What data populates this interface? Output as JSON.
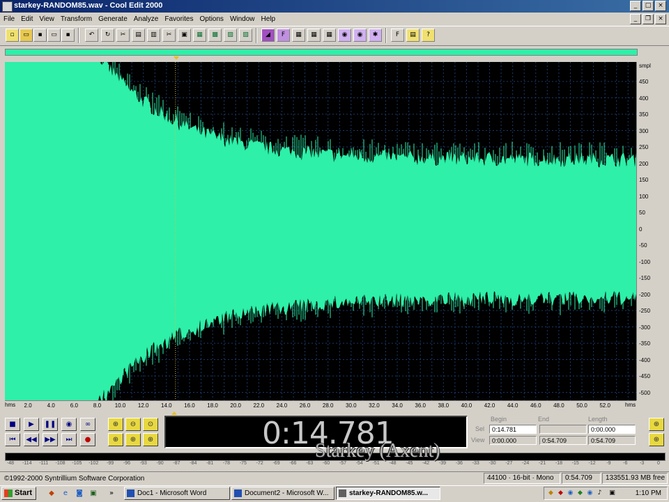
{
  "window": {
    "title": "starkey-RANDOM85.wav - Cool Edit 2000"
  },
  "menu": [
    "File",
    "Edit",
    "View",
    "Transform",
    "Generate",
    "Analyze",
    "Favorites",
    "Options",
    "Window",
    "Help"
  ],
  "timeline": {
    "unit": "hms",
    "ticks": [
      "2.0",
      "4.0",
      "6.0",
      "8.0",
      "10.0",
      "12.0",
      "14.0",
      "16.0",
      "18.0",
      "20.0",
      "22.0",
      "24.0",
      "26.0",
      "28.0",
      "30.0",
      "32.0",
      "34.0",
      "36.0",
      "38.0",
      "40.0",
      "42.0",
      "44.0",
      "46.0",
      "48.0",
      "50.0",
      "52.0"
    ]
  },
  "amplitude_scale": {
    "unit": "smpl",
    "ticks": [
      "450",
      "400",
      "350",
      "300",
      "250",
      "200",
      "150",
      "100",
      "50",
      "0",
      "-50",
      "-100",
      "-150",
      "-200",
      "-250",
      "-300",
      "-350",
      "-400",
      "-450",
      "-500"
    ]
  },
  "time_display": "0:14.781",
  "selection": {
    "headers": {
      "begin": "Begin",
      "end": "End",
      "length": "Length"
    },
    "sel_label": "Sel",
    "view_label": "View",
    "sel": {
      "begin": "0:14.781",
      "end": "",
      "length": "0:00.000"
    },
    "view": {
      "begin": "0:00.000",
      "end": "0:54.709",
      "length": "0:54.709"
    }
  },
  "level_meter": {
    "ticks": [
      "-48",
      "-114",
      "-111",
      "-108",
      "-105",
      "-102",
      "-99",
      "-96",
      "-93",
      "-90",
      "-87",
      "-84",
      "-81",
      "-78",
      "-75",
      "-72",
      "-69",
      "-66",
      "-63",
      "-60",
      "-57",
      "-54",
      "-51",
      "-48",
      "-45",
      "-42",
      "-39",
      "-36",
      "-33",
      "-30",
      "-27",
      "-24",
      "-21",
      "-18",
      "-15",
      "-12",
      "-9",
      "-6",
      "-3",
      "0"
    ]
  },
  "caption": "Starkey (Axent)",
  "status": {
    "copyright": "©1992-2000 Syntrillium Software Corporation",
    "format": "44100 · 16-bit · Mono",
    "duration": "0:54.709",
    "free_space": "133551.93 MB free"
  },
  "taskbar": {
    "start": "Start",
    "tasks": [
      "Doc1 - Microsoft Word",
      "Document2 - Microsoft W...",
      "starkey-RANDOM85.w..."
    ],
    "clock": "1:10 PM"
  },
  "colors": {
    "waveform": "#2ef0a8",
    "background": "#000000",
    "grid": "#1a3a6a"
  }
}
